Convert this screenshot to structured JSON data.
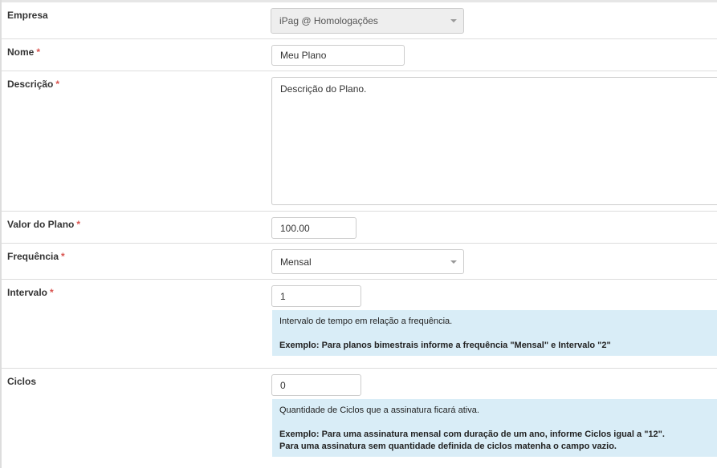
{
  "form": {
    "empresa": {
      "label": "Empresa",
      "value": "iPag @ Homologações"
    },
    "nome": {
      "label": "Nome",
      "required": "*",
      "value": "Meu Plano"
    },
    "descricao": {
      "label": "Descrição",
      "required": "*",
      "value": "Descrição do Plano."
    },
    "valor": {
      "label": "Valor do Plano",
      "required": "*",
      "value": "100.00"
    },
    "frequencia": {
      "label": "Frequência",
      "required": "*",
      "value": "Mensal"
    },
    "intervalo": {
      "label": "Intervalo",
      "required": "*",
      "value": "1",
      "help": "Intervalo de tempo em relação a frequência.",
      "example": "Exemplo: Para planos bimestrais informe a frequência \"Mensal\" e Intervalo \"2\""
    },
    "ciclos": {
      "label": "Ciclos",
      "value": "0",
      "help": "Quantidade de Ciclos que a assinatura ficará ativa.",
      "example_line1": "Exemplo: Para uma assinatura mensal com duração de um ano, informe Ciclos igual a \"12\".",
      "example_line2": "Para uma assinatura sem quantidade definida de ciclos matenha o campo vazio."
    }
  },
  "colors": {
    "required": "#d9534f",
    "help_bg": "#d9edf7",
    "disabled_bg": "#eeeeee"
  }
}
